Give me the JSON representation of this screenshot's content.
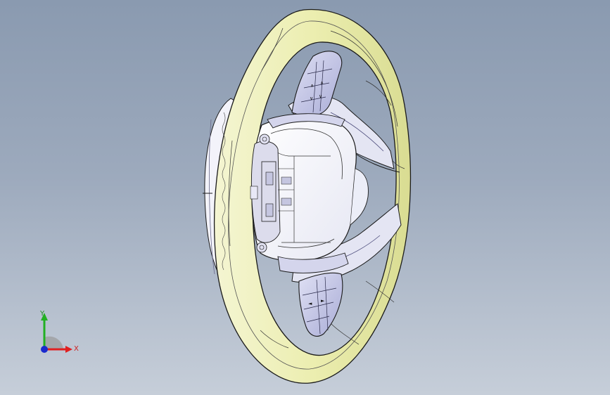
{
  "viewport": {
    "background_top": "#8a9ab0",
    "background_bottom": "#c6ced9",
    "model_name": "steering-wheel",
    "rim_color": "#eef0b6",
    "button_color": "#c9cbe8",
    "edge_color": "#1a1a1a"
  },
  "triad": {
    "x_label": "X",
    "y_label": "Y",
    "x_color": "#e02020",
    "y_color": "#22b022",
    "z_color": "#1a2acd"
  }
}
